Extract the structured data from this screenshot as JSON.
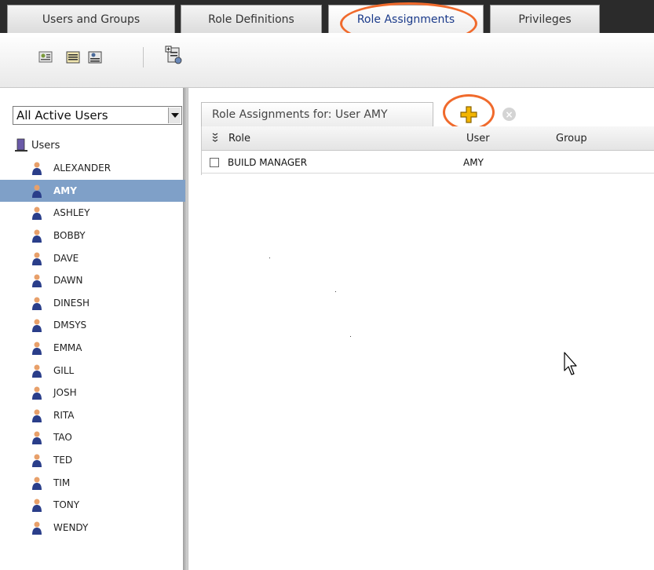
{
  "tabs": [
    {
      "label": "Users and Groups",
      "active": false
    },
    {
      "label": "Role Definitions",
      "active": false
    },
    {
      "label": "Role Assignments",
      "active": true
    },
    {
      "label": "Privileges",
      "active": false
    }
  ],
  "toolbar": {
    "icons": [
      "user-properties-icon",
      "group-properties-icon",
      "role-properties-icon",
      "new-user-group-icon"
    ]
  },
  "filter": {
    "selected": "All Active Users"
  },
  "tree": {
    "root_label": "Users",
    "users": [
      "ALEXANDER",
      "AMY",
      "ASHLEY",
      "BOBBY",
      "DAVE",
      "DAWN",
      "DINESH",
      "DMSYS",
      "EMMA",
      "GILL",
      "JOSH",
      "RITA",
      "TAO",
      "TED",
      "TIM",
      "TONY",
      "WENDY"
    ],
    "selected_user": "AMY"
  },
  "assignments": {
    "tab_title": "Role Assignments for:  User AMY",
    "columns": [
      "Role",
      "User",
      "Group"
    ],
    "rows": [
      {
        "role": "BUILD MANAGER",
        "user": "AMY",
        "group": ""
      }
    ]
  },
  "colors": {
    "highlight": "#f06a2c",
    "selected_row": "#7fa0c8",
    "add_icon": "#f3b500"
  }
}
